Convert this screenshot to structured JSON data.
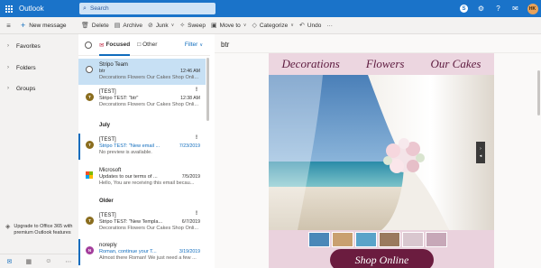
{
  "app": {
    "brand": "Outlook",
    "search_placeholder": "Search",
    "user_initials": "HK"
  },
  "toolbar": {
    "new_message": "New message",
    "delete": "Delete",
    "archive": "Archive",
    "junk": "Junk",
    "sweep": "Sweep",
    "move_to": "Move to",
    "categorize": "Categorize",
    "undo": "Undo",
    "more": "···"
  },
  "nav": {
    "favorites": "Favorites",
    "folders": "Folders",
    "groups": "Groups",
    "upgrade": "Upgrade to Office 365 with premium Outlook features"
  },
  "list": {
    "tab_focused": "Focused",
    "tab_other": "Other",
    "filter": "Filter",
    "group_july": "July",
    "group_older": "Older",
    "messages": [
      {
        "sender": "Stripo Team",
        "subject": "btr",
        "preview": "Decorations Flowers Our Cakes Shop Onli...",
        "time": "12:46 AM",
        "avatar": ""
      },
      {
        "sender": "[TEST]",
        "subject": "Stripo TEST: \"btr\"",
        "preview": "Decorations Flowers Our Cakes Shop Onli...",
        "time": "12:38 AM",
        "avatar": "T"
      },
      {
        "sender": "[TEST]",
        "subject": "Stripo TEST: \"New email ...",
        "preview": "No preview is available.",
        "time": "7/23/2019",
        "avatar": "T"
      },
      {
        "sender": "Microsoft",
        "subject": "Updates to our terms of ...",
        "preview": "Hello, You are receiving this email becau...",
        "time": "7/5/2019",
        "avatar": ""
      },
      {
        "sender": "[TEST]",
        "subject": "Stripo TEST: \"New Templa...",
        "preview": "Decorations Flowers Our Cakes Shop Onli...",
        "time": "6/7/2019",
        "avatar": "T"
      },
      {
        "sender": "noreply",
        "subject": "Roman, continue your T...",
        "preview": "Almost there Roman! We just need a few ...",
        "time": "3/19/2019",
        "avatar": "N"
      }
    ]
  },
  "reading": {
    "title": "btr",
    "nav_links": [
      "Decorations",
      "Flowers",
      "Our Cakes"
    ],
    "shop_button": "Shop Online"
  },
  "colors": {
    "accent": "#0f6cbd",
    "brand_bar": "#1a73c9",
    "email_bg": "#ead2dd",
    "email_accent": "#6b1c3f"
  }
}
